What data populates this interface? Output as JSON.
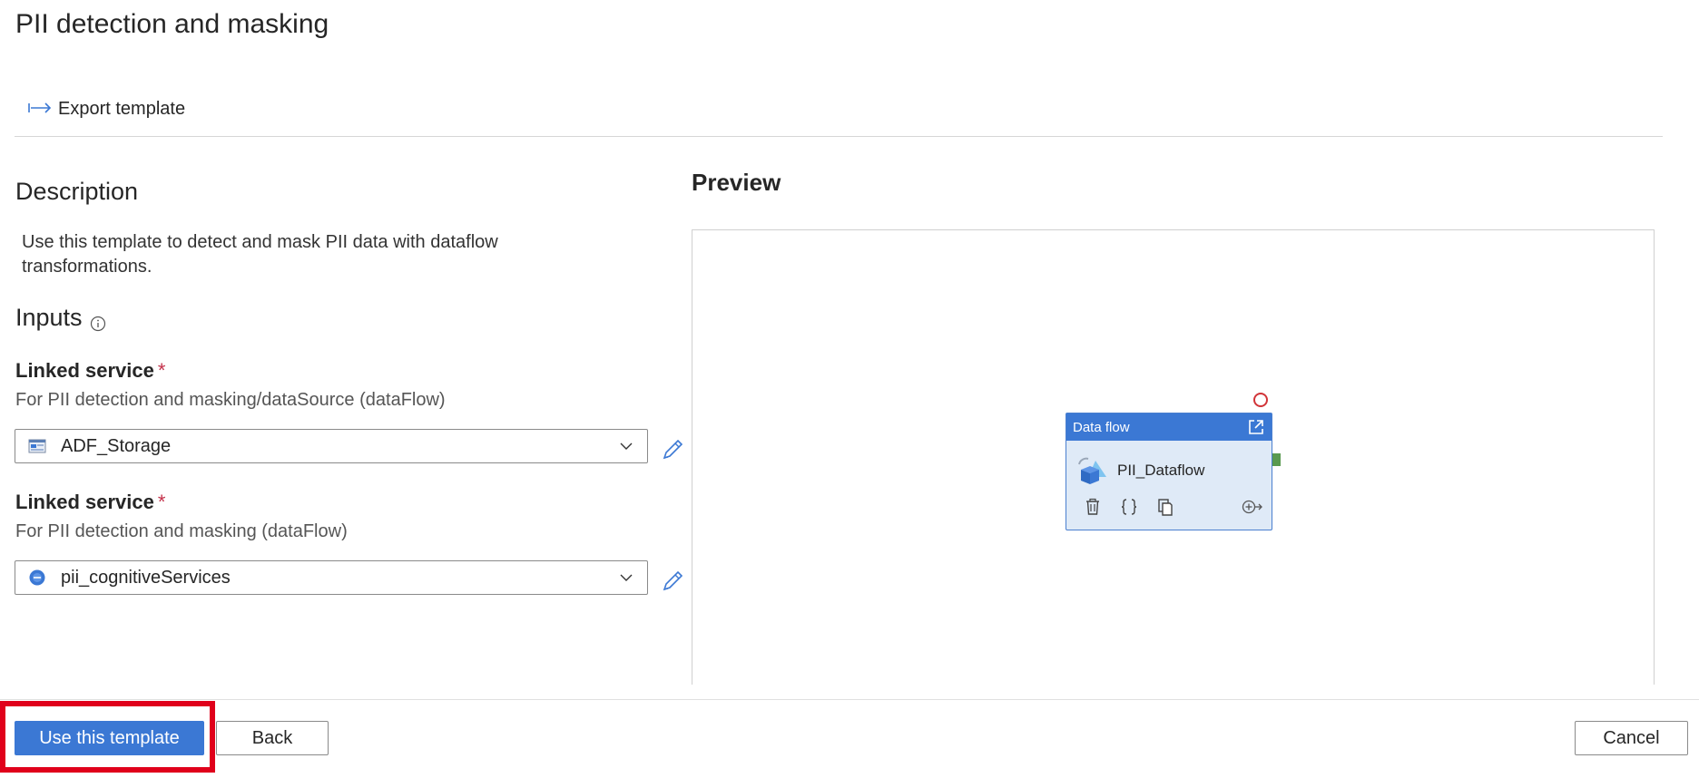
{
  "page_title": "PII detection and masking",
  "toolbar": {
    "export_label": "Export template",
    "export_icon": "export-arrow-icon"
  },
  "description": {
    "title": "Description",
    "text": "Use this template to detect and mask PII data with dataflow transformations."
  },
  "inputs": {
    "title": "Inputs",
    "info_icon": "info-icon",
    "fields": [
      {
        "label": "Linked service",
        "required_mark": "*",
        "sublabel": "For PII detection and masking/dataSource (dataFlow)",
        "value": "ADF_Storage",
        "icon": "storage-account-icon"
      },
      {
        "label": "Linked service",
        "required_mark": "*",
        "sublabel": "For PII detection and masking (dataFlow)",
        "value": "pii_cognitiveServices",
        "icon": "cognitive-services-icon"
      }
    ]
  },
  "preview": {
    "title": "Preview",
    "activity": {
      "type_label": "Data flow",
      "name": "PII_Dataflow",
      "actions": [
        "delete-icon",
        "code-icon",
        "copy-icon",
        "add-output-icon"
      ]
    }
  },
  "footer": {
    "primary_label": "Use this template",
    "back_label": "Back",
    "cancel_label": "Cancel"
  },
  "colors": {
    "accent": "#3b78d4",
    "highlight": "#e0001b",
    "required": "#c4314b",
    "activity_bg": "#dfeaf7",
    "status_error": "#d13438",
    "output_port": "#5a9a4f"
  }
}
